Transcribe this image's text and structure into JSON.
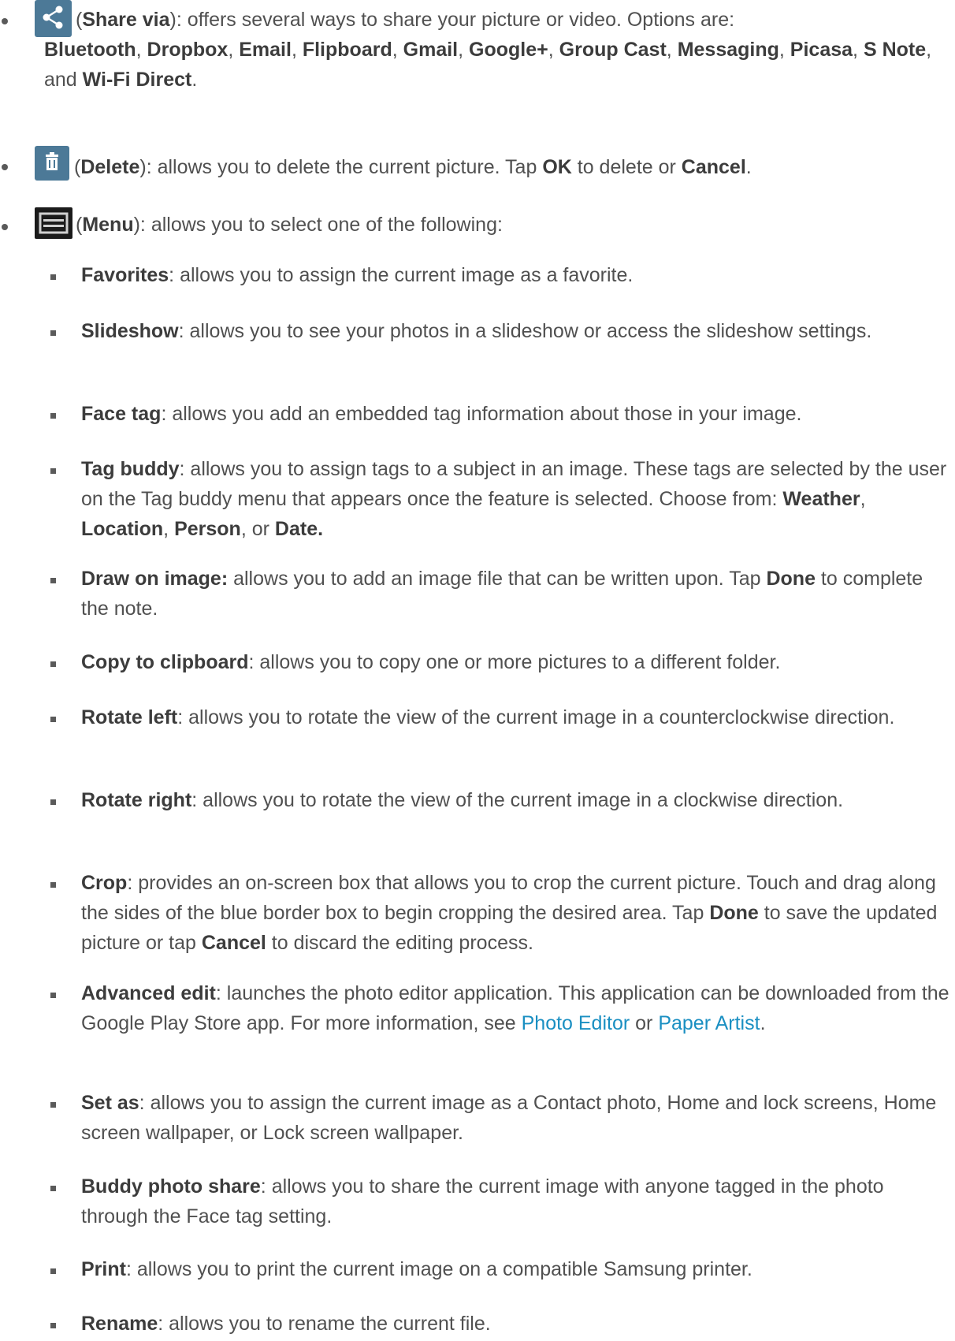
{
  "bullets": {
    "share": {
      "icon": "share-icon",
      "open": " (",
      "label": "Share via",
      "desc": "): offers several ways to share your picture or video. Options are: ",
      "options": [
        "Bluetooth",
        "Dropbox",
        "Email",
        "Flipboard",
        "Gmail",
        "Google+",
        "Group Cast",
        "Messaging",
        "Picasa",
        "S Note"
      ],
      "sep": ", ",
      "and_text": ", and ",
      "last_option": "Wi-Fi Direct",
      "end": "."
    },
    "delete": {
      "icon": "trash-icon",
      "open": " (",
      "label": "Delete",
      "desc": "): allows you to delete the current picture. Tap ",
      "ok": "OK",
      "mid": " to delete or ",
      "cancel": "Cancel",
      "end": "."
    },
    "menu": {
      "icon": "menu-icon",
      "open": " (",
      "label": "Menu",
      "desc": "): allows you to select one of the following:"
    }
  },
  "menu_items": [
    {
      "t": "Favorites",
      "d": ": allows you to assign the current image as a favorite."
    },
    {
      "t": "Slideshow",
      "d": ": allows you to see your photos in  a slideshow or access the slideshow settings."
    },
    {
      "t": "Face tag",
      "d": ": allows you add an embedded tag information about those in your image."
    },
    {
      "t": "Tag buddy",
      "d": ": allows you to assign tags to a subject in an image. These tags are selected by the user on the Tag buddy menu that appears once the feature is selected. Choose from: ",
      "b1": "Weather",
      "s1": ", ",
      "b2": "Location",
      "s2": ", ",
      "b3": "Person",
      "s3": ", or ",
      "b4": "Date."
    },
    {
      "t": "Draw on image:",
      "d": " allows you to add an image file that can be written upon. Tap ",
      "b1": "Done",
      "s1": " to complete the note."
    },
    {
      "t": "Copy to clipboard",
      "d": ": allows you to copy one or more pictures to a different folder."
    },
    {
      "t": "Rotate left",
      "d": ": allows you to rotate the view of the current image in a counterclockwise direction."
    },
    {
      "t": "Rotate right",
      "d": ": allows you to rotate the view of the current image in a clockwise direction."
    },
    {
      "t": "Crop",
      "d": ": provides an on-screen box that allows you to crop the current picture. Touch and drag along the sides of the blue border box to begin cropping the desired area. Tap ",
      "b1": "Done",
      "s1": " to save the updated picture or tap ",
      "b2": "Cancel",
      "s2": " to discard the editing process."
    },
    {
      "t": "Advanced edit",
      "d": ": launches the photo editor application. This application can be downloaded from the Google Play Store app. For more information, see ",
      "l1": "Photo Editor",
      "s1": " or ",
      "l2": "Paper Artist",
      "s2": "."
    },
    {
      "t": "Set as",
      "d": ": allows you to assign the current image as a Contact photo, Home and lock screens, Home screen wallpaper, or Lock screen wallpaper."
    },
    {
      "t": "Buddy photo share",
      "d": ": allows you to share the current image with anyone tagged in the photo through the Face tag setting."
    },
    {
      "t": "Print",
      "d": ": allows you to print the current image on a compatible Samsung printer."
    },
    {
      "t": "Rename",
      "d": ": allows you to rename the current file."
    }
  ]
}
